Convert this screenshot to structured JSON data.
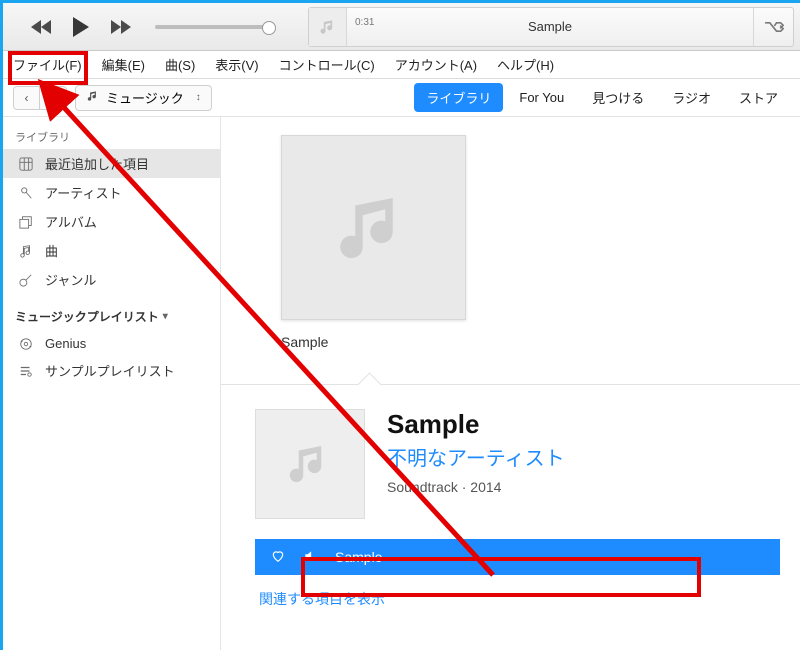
{
  "player": {
    "now_playing_title": "Sample",
    "elapsed": "0:31"
  },
  "menu": {
    "file": "ファイル(F)",
    "edit": "編集(E)",
    "song": "曲(S)",
    "view": "表示(V)",
    "control": "コントロール(C)",
    "account": "アカウント(A)",
    "help": "ヘルプ(H)"
  },
  "media_selector": {
    "label": "ミュージック"
  },
  "tabs": {
    "library": "ライブラリ",
    "for_you": "For You",
    "browse": "見つける",
    "radio": "ラジオ",
    "store": "ストア"
  },
  "sidebar": {
    "section_library": "ライブラリ",
    "items": {
      "recently_added": "最近追加した項目",
      "artists": "アーティスト",
      "albums": "アルバム",
      "songs": "曲",
      "genres": "ジャンル"
    },
    "section_playlists": "ミュージックプレイリスト",
    "playlists": {
      "genius": "Genius",
      "sample": "サンプルプレイリスト"
    }
  },
  "album": {
    "caption": "Sample"
  },
  "detail": {
    "title": "Sample",
    "artist": "不明なアーティスト",
    "genre": "Soundtrack",
    "year": "2014",
    "sep": " · ",
    "track_name": "Sample",
    "related": "関連する項目を表示"
  }
}
